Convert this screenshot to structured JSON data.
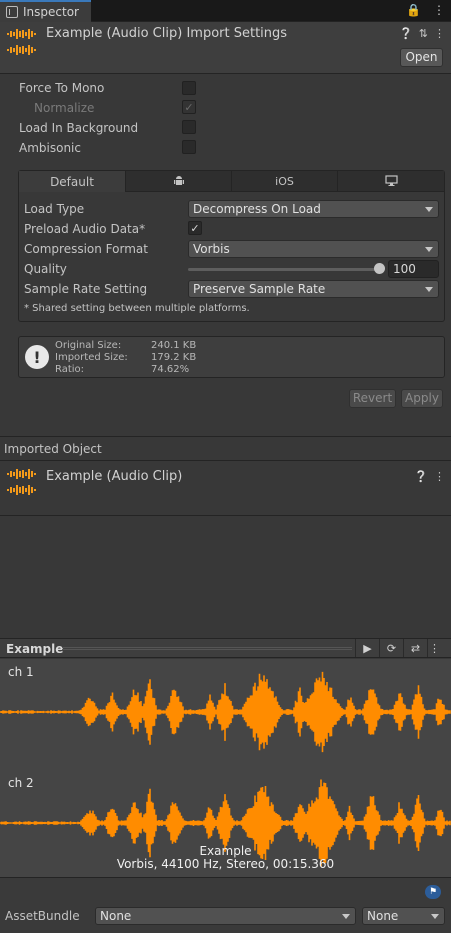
{
  "tab": {
    "label": "Inspector"
  },
  "header": {
    "title": "Example (Audio Clip) Import Settings",
    "open_label": "Open"
  },
  "settings": {
    "force_to_mono": {
      "label": "Force To Mono",
      "checked": false
    },
    "normalize": {
      "label": "Normalize",
      "checked": true
    },
    "load_in_background": {
      "label": "Load In Background",
      "checked": false
    },
    "ambisonic": {
      "label": "Ambisonic",
      "checked": false
    }
  },
  "platform_tabs": [
    "Default",
    "android-icon",
    "iOS",
    "desktop-icon"
  ],
  "platform_tabs_text": {
    "default": "Default",
    "ios": "iOS"
  },
  "platform": {
    "load_type": {
      "label": "Load Type",
      "value": "Decompress On Load"
    },
    "preload_audio_data": {
      "label": "Preload Audio Data*",
      "checked": true
    },
    "compression_format": {
      "label": "Compression Format",
      "value": "Vorbis"
    },
    "quality": {
      "label": "Quality",
      "value": "100",
      "level": 1.0
    },
    "sample_rate_setting": {
      "label": "Sample Rate Setting",
      "value": "Preserve Sample Rate"
    },
    "note": "* Shared setting between multiple platforms."
  },
  "info": {
    "original_size_label": "Original Size:",
    "original_size": "240.1 KB",
    "imported_size_label": "Imported Size:",
    "imported_size": "179.2 KB",
    "ratio_label": "Ratio:",
    "ratio": "74.62%"
  },
  "actions": {
    "revert": "Revert",
    "apply": "Apply"
  },
  "imported_object": {
    "section_label": "Imported Object",
    "title": "Example (Audio Clip)"
  },
  "preview": {
    "title": "Example",
    "ch1": "ch 1",
    "ch2": "ch 2",
    "clip_name": "Example",
    "clip_info": "Vorbis, 44100 Hz, Stereo, 00:15.360"
  },
  "asset_bundle": {
    "label": "AssetBundle",
    "name": "None",
    "variant": "None"
  },
  "colors": {
    "accent": "#3a79bb",
    "waveform": "#ff8c00",
    "background": "#383838"
  }
}
